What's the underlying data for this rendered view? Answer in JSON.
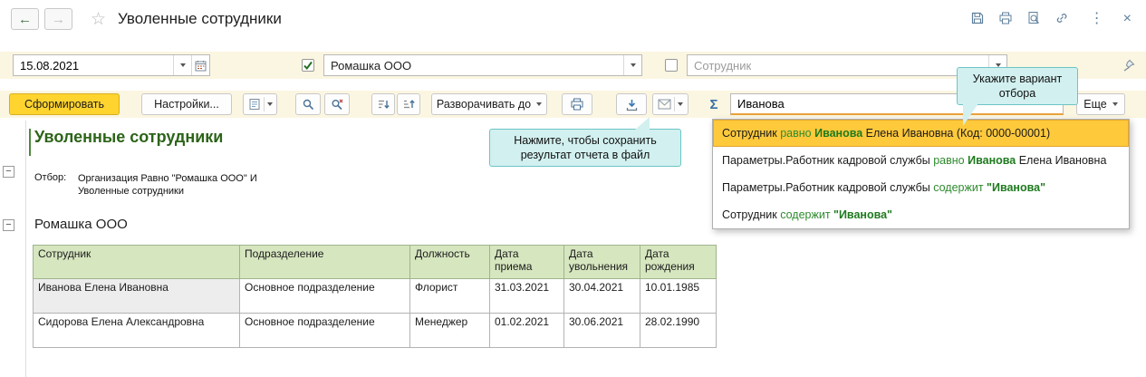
{
  "window": {
    "title": "Уволенные сотрудники"
  },
  "icons": {
    "back_arrow": "←",
    "forward_arrow": "→",
    "star": "☆",
    "more_vertical": "⋮",
    "close": "×",
    "sigma": "Σ",
    "collapse": "−"
  },
  "filters": {
    "date_value": "15.08.2021",
    "org": {
      "checked": true,
      "value": "Ромашка ООО"
    },
    "employee": {
      "checked": false,
      "placeholder": "Сотрудник"
    }
  },
  "toolbar": {
    "generate": "Сформировать",
    "settings": "Настройки...",
    "expand_to": "Разворачивать до",
    "search_value": "Иванова",
    "more": "Еще"
  },
  "tooltips": {
    "variant_line1": "Укажите вариант",
    "variant_line2": "отбора",
    "save_line1": "Нажмите, чтобы сохранить",
    "save_line2": "результат отчета в файл"
  },
  "dropdown": {
    "items": [
      {
        "selected": true,
        "segments": [
          {
            "text": "Сотрудник ",
            "style": "normal"
          },
          {
            "text": "равно ",
            "style": "green"
          },
          {
            "text": "Иванова",
            "style": "green-bold"
          },
          {
            "text": " Елена Ивановна (Код: 0000-00001)",
            "style": "normal"
          }
        ]
      },
      {
        "selected": false,
        "segments": [
          {
            "text": "Параметры.Работник кадровой службы ",
            "style": "normal"
          },
          {
            "text": "равно ",
            "style": "green"
          },
          {
            "text": "Иванова",
            "style": "green-bold"
          },
          {
            "text": " Елена Ивановна",
            "style": "normal"
          }
        ]
      },
      {
        "selected": false,
        "segments": [
          {
            "text": "Параметры.Работник кадровой службы ",
            "style": "normal"
          },
          {
            "text": "содержит ",
            "style": "green"
          },
          {
            "text": "\"Иванова\"",
            "style": "green-bold"
          }
        ]
      },
      {
        "selected": false,
        "segments": [
          {
            "text": "Сотрудник ",
            "style": "normal"
          },
          {
            "text": "содержит ",
            "style": "green"
          },
          {
            "text": "\"Иванова\"",
            "style": "green-bold"
          }
        ]
      }
    ]
  },
  "report": {
    "title": "Уволенные сотрудники",
    "selection_label": "Отбор:",
    "selection_lines": [
      "Организация Равно \"Ромашка ООО\" И",
      "Уволенные сотрудники"
    ],
    "group_title": "Ромашка ООО",
    "table": {
      "headers": [
        "Сотрудник",
        "Подразделение",
        "Должность",
        "Дата приема",
        "Дата увольнения",
        "Дата рождения"
      ],
      "rows": [
        [
          "Иванова Елена Ивановна",
          "Основное подразделение",
          "Флорист",
          "31.03.2021",
          "30.04.2021",
          "10.01.1985"
        ],
        [
          "Сидорова Елена Александровна",
          "Основное подразделение",
          "Менеджер",
          "01.02.2021",
          "30.06.2021",
          "28.02.1990"
        ]
      ]
    }
  }
}
